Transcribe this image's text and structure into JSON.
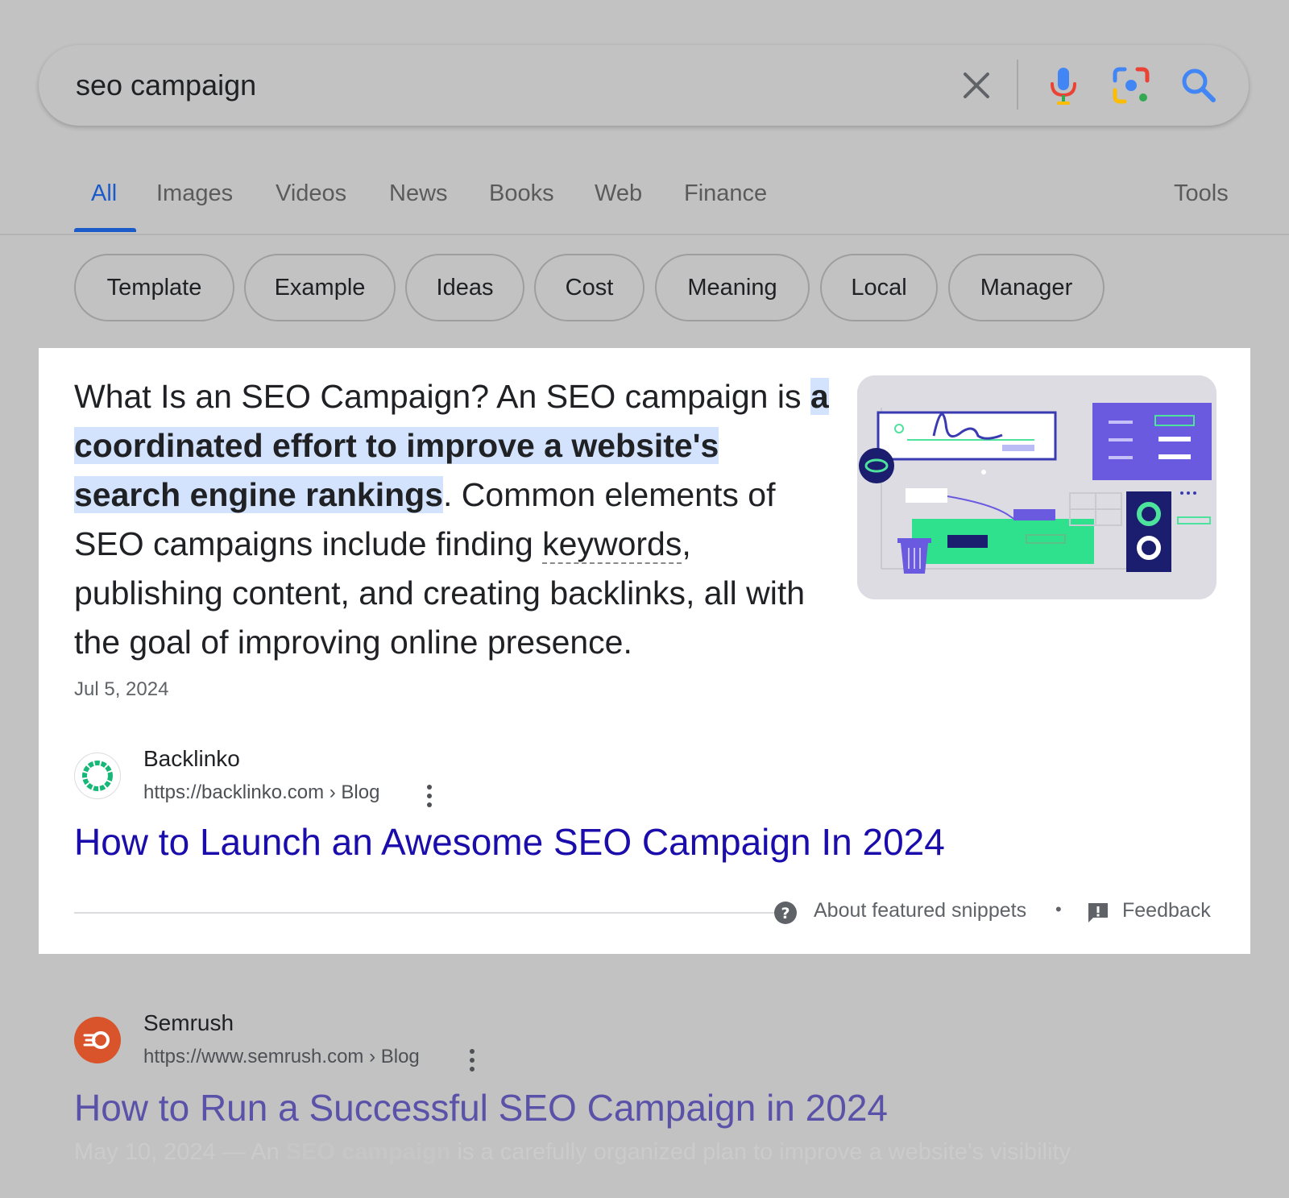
{
  "search": {
    "query": "seo campaign"
  },
  "icons": {
    "clear": "close-icon",
    "voice": "microphone-icon",
    "lens": "camera-lens-icon",
    "search": "search-icon",
    "help": "question-circle-icon",
    "feedback": "feedback-icon",
    "more": "more-vert-icon"
  },
  "colors": {
    "accent_blue": "#1a5bc9",
    "link": "#1a0dab",
    "highlight": "#d3e3fd"
  },
  "tabs": [
    {
      "label": "All",
      "active": true
    },
    {
      "label": "Images"
    },
    {
      "label": "Videos"
    },
    {
      "label": "News"
    },
    {
      "label": "Books"
    },
    {
      "label": "Web"
    },
    {
      "label": "Finance"
    }
  ],
  "tools_label": "Tools",
  "chips": [
    "Template",
    "Example",
    "Ideas",
    "Cost",
    "Meaning",
    "Local",
    "Manager"
  ],
  "snippet": {
    "text_before": "What Is an SEO Campaign? An SEO campaign is ",
    "text_highlight": "a coordinated effort to improve a website's search engine rankings",
    "text_middle": ". Common elements of SEO campaigns include finding ",
    "text_keyword": "keywords",
    "text_after": ", publishing content, and creating backlinks, all with the goal of improving online presence.",
    "date": "Jul 5, 2024",
    "source": {
      "name": "Backlinko",
      "url": "https://backlinko.com › Blog"
    },
    "title": "How to Launch an Awesome SEO Campaign In 2024",
    "about_label": "About featured snippets",
    "separator": "•",
    "feedback_label": "Feedback"
  },
  "results": [
    {
      "name": "Semrush",
      "url": "https://www.semrush.com › Blog",
      "title": "How to Run a Successful SEO Campaign in 2024",
      "date_prefix": "May 10, 2024 — An ",
      "snippet_bold": "SEO campaign",
      "snippet_rest": " is a carefully organized plan to improve a website's visibility"
    }
  ]
}
